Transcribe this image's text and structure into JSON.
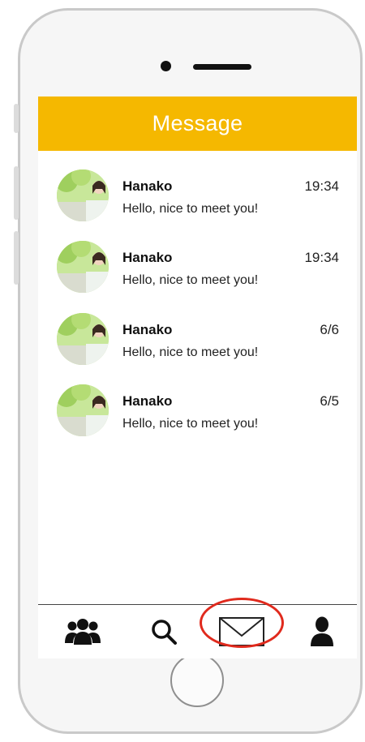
{
  "header": {
    "title": "Message"
  },
  "messages": [
    {
      "name": "Hanako",
      "time": "19:34",
      "text": "Hello, nice to meet you!"
    },
    {
      "name": "Hanako",
      "time": "19:34",
      "text": "Hello, nice to meet you!"
    },
    {
      "name": "Hanako",
      "time": "6/6",
      "text": "Hello, nice to meet you!"
    },
    {
      "name": "Hanako",
      "time": "6/5",
      "text": "Hello, nice to meet you!"
    }
  ],
  "tabbar": {
    "tabs": [
      {
        "icon": "people-icon"
      },
      {
        "icon": "search-icon"
      },
      {
        "icon": "mail-icon",
        "active": true
      },
      {
        "icon": "user-icon"
      }
    ]
  },
  "colors": {
    "header": "#f5b800",
    "highlight": "#e02a1d",
    "frame": "#c9c9c9"
  }
}
